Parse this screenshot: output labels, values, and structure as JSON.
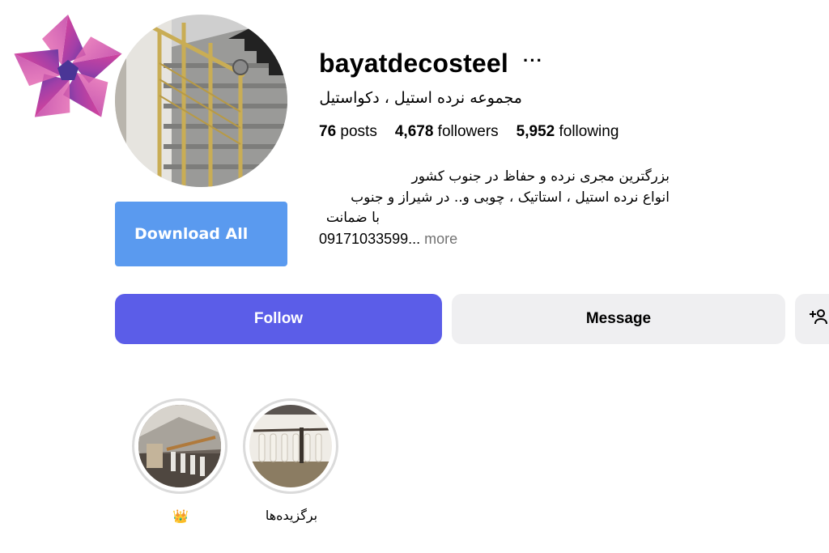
{
  "profile": {
    "username": "bayatdecosteel",
    "more_icon": "···",
    "full_name": "مجموعه نرده استیل ، دکواستیل",
    "stats": {
      "posts_count": "76",
      "posts_label": "posts",
      "followers_count": "4,678",
      "followers_label": "followers",
      "following_count": "5,952",
      "following_label": "following"
    },
    "bio": {
      "line1": "بزرگترین مجری نرده و حفاظ در جنوب کشور",
      "line2": "انواع نرده استیل ، استاتیک ، چوبی و.. در شیراز و جنوب",
      "line3": "با ضمانت",
      "phone": "09171033599...",
      "more": "more"
    }
  },
  "actions": {
    "download_all": "Download All",
    "follow": "Follow",
    "message": "Message"
  },
  "highlights": [
    {
      "label": "👑"
    },
    {
      "label": "برگزیده‌ها"
    }
  ],
  "colors": {
    "follow_bg": "#5b5de8",
    "download_bg": "#5a9aef",
    "secondary_btn_bg": "#efeff1",
    "muted_text": "#737373"
  },
  "icons": {
    "logo": "pinwheel-logo",
    "add_user": "add-user-icon"
  }
}
